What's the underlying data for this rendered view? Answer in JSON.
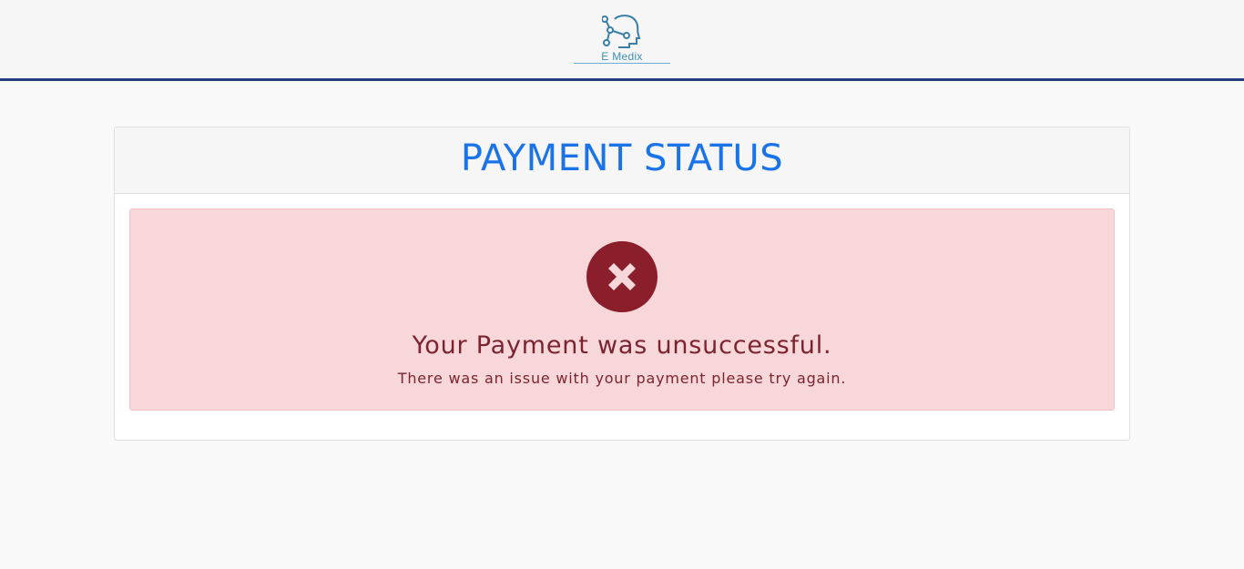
{
  "header": {
    "logo_text": "E Medix",
    "colors": {
      "bar_border": "#213f7f",
      "logo": "#3d8fb8"
    }
  },
  "card": {
    "title": "PAYMENT STATUS",
    "title_color": "#1a73e8"
  },
  "alert": {
    "icon": "error-x-circle-icon",
    "heading": "Your Payment was unsuccessful.",
    "message": "There was an issue with your payment please try again.",
    "colors": {
      "background": "#f8d7da",
      "text": "#7b2430",
      "icon": "#8b1e2b"
    }
  }
}
